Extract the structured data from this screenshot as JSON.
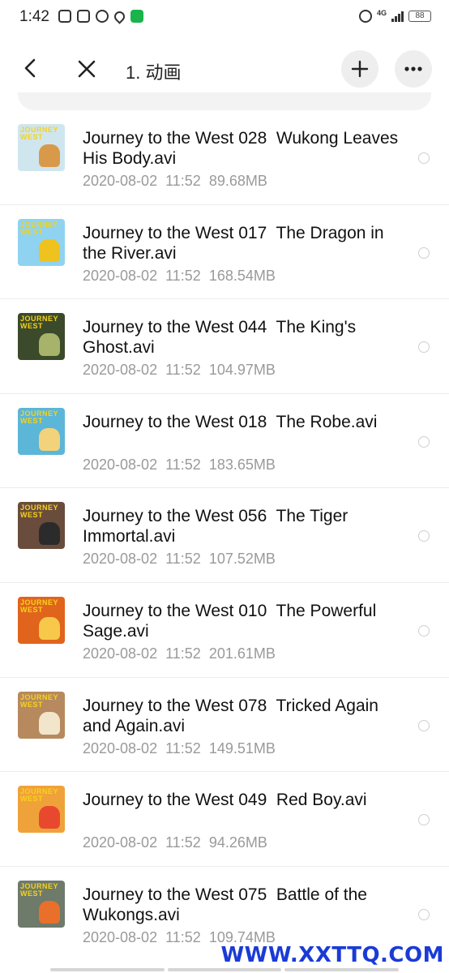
{
  "status_bar": {
    "time": "1:42",
    "network": "4G",
    "battery": "88"
  },
  "header": {
    "title": "1. 动画"
  },
  "files": [
    {
      "name": "Journey to the West 028  Wukong Leaves His Body.avi",
      "date": "2020-08-02",
      "time": "11:52",
      "size": "89.68MB"
    },
    {
      "name": "Journey to the West 017  The Dragon in the River.avi",
      "date": "2020-08-02",
      "time": "11:52",
      "size": "168.54MB"
    },
    {
      "name": "Journey to the West 044  The King's Ghost.avi",
      "date": "2020-08-02",
      "time": "11:52",
      "size": "104.97MB"
    },
    {
      "name": "Journey to the West 018  The Robe.avi",
      "date": "2020-08-02",
      "time": "11:52",
      "size": "183.65MB"
    },
    {
      "name": "Journey to the West 056  The Tiger Immortal.avi",
      "date": "2020-08-02",
      "time": "11:52",
      "size": "107.52MB"
    },
    {
      "name": "Journey to the West 010  The Powerful Sage.avi",
      "date": "2020-08-02",
      "time": "11:52",
      "size": "201.61MB"
    },
    {
      "name": "Journey to the West 078  Tricked Again and Again.avi",
      "date": "2020-08-02",
      "time": "11:52",
      "size": "149.51MB"
    },
    {
      "name": "Journey to the West 049  Red Boy.avi",
      "date": "2020-08-02",
      "time": "11:52",
      "size": "94.26MB"
    },
    {
      "name": "Journey to the West 075  Battle of the Wukongs.avi",
      "date": "2020-08-02",
      "time": "11:52",
      "size": "109.74MB"
    }
  ],
  "thumbnail_colors": [
    {
      "bg": "#cfe6ef",
      "fig": "#d89a4a"
    },
    {
      "bg": "#8fd3f0",
      "fig": "#f0c21e"
    },
    {
      "bg": "#3b4a2a",
      "fig": "#a7b36a"
    },
    {
      "bg": "#5cb6d8",
      "fig": "#f2d27a"
    },
    {
      "bg": "#6a4c3c",
      "fig": "#2b2b2b"
    },
    {
      "bg": "#e0641c",
      "fig": "#f7c84a"
    },
    {
      "bg": "#b68a5e",
      "fig": "#f1e6cc"
    },
    {
      "bg": "#f0a23a",
      "fig": "#e8492e"
    },
    {
      "bg": "#6e7a6a",
      "fig": "#e8702a"
    }
  ],
  "thumbnail_logo": "JOURNEY WEST",
  "watermark": "WWW.XXTTQ.COM"
}
